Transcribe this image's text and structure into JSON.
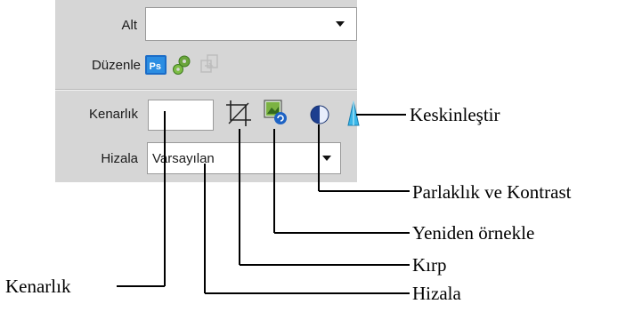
{
  "panel": {
    "alt_label": "Alt",
    "alt_value": "",
    "edit_label": "Düzenle",
    "border_label": "Kenarlık",
    "border_value": "",
    "align_label": "Hizala",
    "align_value": "Varsayılan"
  },
  "icons": {
    "ps": "photoshop-icon",
    "settings": "gear-icon",
    "update": "update-icon",
    "crop": "crop-icon",
    "resample": "resample-icon",
    "brightness": "brightness-contrast-icon",
    "sharpen": "sharpen-icon"
  },
  "callouts": {
    "sharpen": "Keskinleştir",
    "brightness": "Parlaklık ve Kontrast",
    "resample": "Yeniden örnekle",
    "crop": "Kırp",
    "border": "Kenarlık",
    "align": "Hizala"
  }
}
